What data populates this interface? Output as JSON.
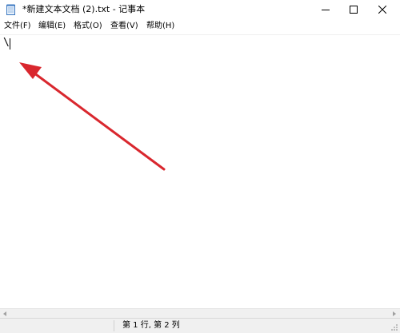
{
  "window": {
    "title": "*新建文本文档 (2).txt - 记事本"
  },
  "menu": {
    "items": [
      {
        "label": "文件(F)"
      },
      {
        "label": "编辑(E)"
      },
      {
        "label": "格式(O)"
      },
      {
        "label": "查看(V)"
      },
      {
        "label": "帮助(H)"
      }
    ]
  },
  "editor": {
    "content": "\\"
  },
  "status": {
    "position": "第 1 行, 第 2 列"
  },
  "colors": {
    "arrow": "#d9272e",
    "statusbar": "#f0f0f0",
    "background": "#ffffff"
  },
  "icons": {
    "app": "notepad-icon",
    "minimize": "minimize-icon",
    "maximize": "maximize-icon",
    "close": "close-icon",
    "annotation": "red-arrow-annotation"
  }
}
